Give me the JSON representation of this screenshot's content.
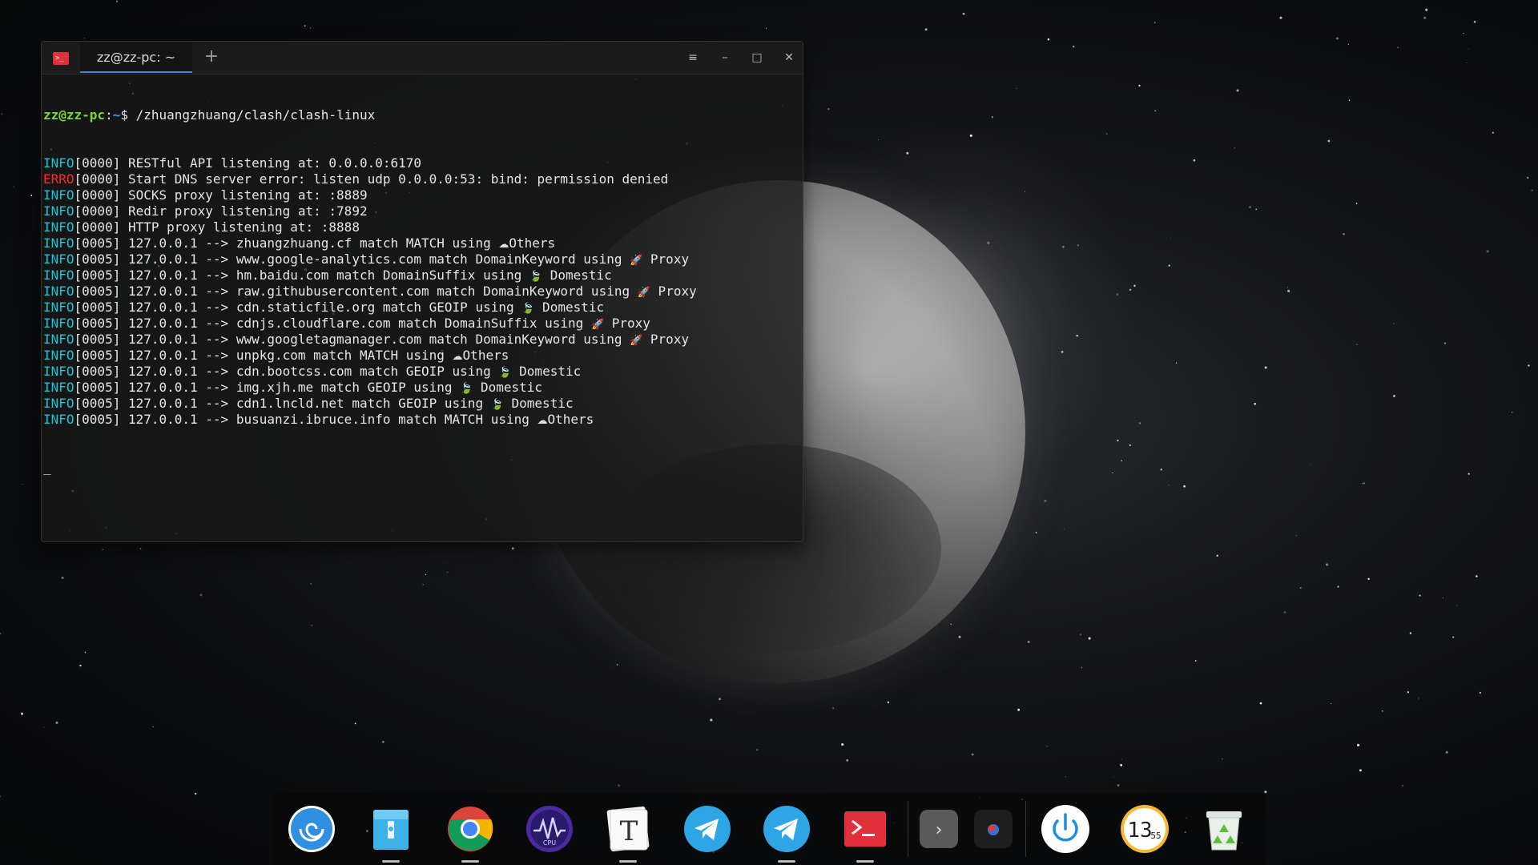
{
  "window": {
    "tab_title": "zz@zz-pc: ~",
    "new_tab_symbol": "+",
    "menu_symbol": "≡",
    "minimize_symbol": "–",
    "maximize_symbol": "□",
    "close_symbol": "✕"
  },
  "terminal": {
    "prompt_user": "zz@zz-pc",
    "prompt_sep": ":",
    "prompt_path": "~",
    "prompt_dollar": "$ ",
    "command": "/zhuangzhuang/clash/clash-linux",
    "lines": [
      {
        "tag": "INFO",
        "level": "info",
        "text": "[0000] RESTful API listening at: 0.0.0.0:6170",
        "icon": "",
        "suffix": ""
      },
      {
        "tag": "ERRO",
        "level": "error",
        "text": "[0000] Start DNS server error: listen udp 0.0.0.0:53: bind: permission denied",
        "icon": "",
        "suffix": ""
      },
      {
        "tag": "INFO",
        "level": "info",
        "text": "[0000] SOCKS proxy listening at: :8889",
        "icon": "",
        "suffix": ""
      },
      {
        "tag": "INFO",
        "level": "info",
        "text": "[0000] Redir proxy listening at: :7892",
        "icon": "",
        "suffix": ""
      },
      {
        "tag": "INFO",
        "level": "info",
        "text": "[0000] HTTP proxy listening at: :8888",
        "icon": "",
        "suffix": ""
      },
      {
        "tag": "INFO",
        "level": "info",
        "text": "[0005] 127.0.0.1 --> zhuangzhuang.cf match MATCH using ",
        "icon": "☁",
        "suffix": "Others"
      },
      {
        "tag": "INFO",
        "level": "info",
        "text": "[0005] 127.0.0.1 --> www.google-analytics.com match DomainKeyword using ",
        "icon": "🚀",
        "suffix": " Proxy"
      },
      {
        "tag": "INFO",
        "level": "info",
        "text": "[0005] 127.0.0.1 --> hm.baidu.com match DomainSuffix using ",
        "icon": "🍃",
        "suffix": " Domestic"
      },
      {
        "tag": "INFO",
        "level": "info",
        "text": "[0005] 127.0.0.1 --> raw.githubusercontent.com match DomainKeyword using ",
        "icon": "🚀",
        "suffix": " Proxy"
      },
      {
        "tag": "INFO",
        "level": "info",
        "text": "[0005] 127.0.0.1 --> cdn.staticfile.org match GEOIP using ",
        "icon": "🍃",
        "suffix": " Domestic"
      },
      {
        "tag": "INFO",
        "level": "info",
        "text": "[0005] 127.0.0.1 --> cdnjs.cloudflare.com match DomainSuffix using ",
        "icon": "🚀",
        "suffix": " Proxy"
      },
      {
        "tag": "INFO",
        "level": "info",
        "text": "[0005] 127.0.0.1 --> www.googletagmanager.com match DomainKeyword using ",
        "icon": "🚀",
        "suffix": " Proxy"
      },
      {
        "tag": "INFO",
        "level": "info",
        "text": "[0005] 127.0.0.1 --> unpkg.com match MATCH using ",
        "icon": "☁",
        "suffix": "Others"
      },
      {
        "tag": "INFO",
        "level": "info",
        "text": "[0005] 127.0.0.1 --> cdn.bootcss.com match GEOIP using ",
        "icon": "🍃",
        "suffix": " Domestic"
      },
      {
        "tag": "INFO",
        "level": "info",
        "text": "[0005] 127.0.0.1 --> img.xjh.me match GEOIP using ",
        "icon": "🍃",
        "suffix": " Domestic"
      },
      {
        "tag": "INFO",
        "level": "info",
        "text": "[0005] 127.0.0.1 --> cdn1.lncld.net match GEOIP using ",
        "icon": "🍃",
        "suffix": " Domestic"
      },
      {
        "tag": "INFO",
        "level": "info",
        "text": "[0005] 127.0.0.1 --> busuanzi.ibruce.info match MATCH using ",
        "icon": "☁",
        "suffix": "Others"
      }
    ],
    "cursor": "_"
  },
  "dock": {
    "items": [
      {
        "name": "deepin-launcher-icon",
        "label": "",
        "running": false
      },
      {
        "name": "file-manager-icon",
        "label": "",
        "running": true
      },
      {
        "name": "chrome-icon",
        "label": "",
        "running": true
      },
      {
        "name": "system-monitor-icon",
        "label": "CPU",
        "running": false
      },
      {
        "name": "typora-icon",
        "label": "T",
        "running": true
      },
      {
        "name": "telegram-icon",
        "label": "",
        "running": false
      },
      {
        "name": "telegram-icon-2",
        "label": "",
        "running": true
      },
      {
        "name": "terminal-icon",
        "label": ">_",
        "running": true
      },
      {
        "name": "tray-expand-icon",
        "label": "›",
        "running": false
      },
      {
        "name": "tray-app-icon",
        "label": "",
        "running": false
      },
      {
        "name": "power-icon",
        "label": "",
        "running": false
      },
      {
        "name": "clock-icon",
        "label": "13",
        "running": false
      },
      {
        "name": "trash-icon",
        "label": "",
        "running": false
      }
    ],
    "clock_minutes": "55",
    "colors": {
      "launcher": "#2f8fe0",
      "chrome_red": "#db4437",
      "chrome_yellow": "#f4b400",
      "chrome_green": "#0f9d58",
      "chrome_blue": "#4285f4",
      "telegram": "#2ea6e5",
      "terminal": "#e0313b",
      "power": "#1d8fe0",
      "clock": "#f5b82e"
    }
  },
  "colors": {
    "info_tag": "#1ec3d6",
    "error_tag": "#ff2a2a",
    "prompt_user": "#7cd63a",
    "prompt_path": "#3c9ee8",
    "tab_accent": "#2f87e6"
  }
}
